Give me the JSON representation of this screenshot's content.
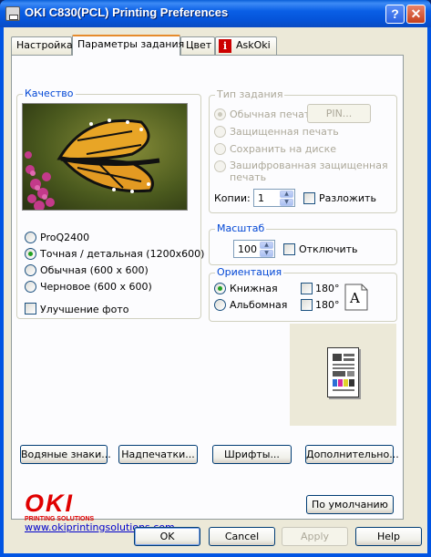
{
  "window": {
    "title": "OKI C830(PCL) Printing Preferences",
    "help_glyph": "?",
    "close_glyph": "✕"
  },
  "tabs": [
    {
      "label": "Настройка"
    },
    {
      "label": "Параметры задания"
    },
    {
      "label": "Цвет"
    },
    {
      "label": "AskOki"
    }
  ],
  "quality": {
    "label": "Качество",
    "options": [
      {
        "label": "ProQ2400",
        "selected": false
      },
      {
        "label": "Точная / детальная (1200x600)",
        "selected": true
      },
      {
        "label": "Обычная (600 x 600)",
        "selected": false
      },
      {
        "label": "Черновое (600 x 600)",
        "selected": false
      }
    ],
    "photo_enhance": {
      "label": "Улучшение фото",
      "checked": false
    }
  },
  "job_type": {
    "label": "Тип задания",
    "options": [
      {
        "label": "Обычная печать",
        "selected": true
      },
      {
        "label": "Защищенная печать",
        "selected": false
      },
      {
        "label": "Сохранить на диске",
        "selected": false
      },
      {
        "label": "Зашифрованная защищенная",
        "selected": false
      }
    ],
    "option4_line2": "печать",
    "pin_button": "PIN...",
    "copies_label": "Копии:",
    "copies_value": "1",
    "collate": {
      "label": "Разложить",
      "checked": false
    }
  },
  "scale": {
    "label": "Масштаб",
    "value": "100",
    "disable": {
      "label": "Отключить",
      "checked": false
    }
  },
  "orientation": {
    "label": "Ориентация",
    "portrait": {
      "label": "Книжная",
      "selected": true
    },
    "landscape": {
      "label": "Альбомная",
      "selected": false
    },
    "rotate_portrait": {
      "label": "180°",
      "checked": false
    },
    "rotate_landscape": {
      "label": "180°",
      "checked": false
    },
    "icon_letter": "A"
  },
  "buttons": {
    "watermarks": "Водяные знаки...",
    "overlays": "Надпечатки...",
    "fonts": "Шрифты...",
    "advanced": "Дополнительно...",
    "defaults": "По умолчанию",
    "ok": "OK",
    "cancel": "Cancel",
    "apply": "Apply",
    "help": "Help"
  },
  "brand": {
    "logo": "OKI",
    "tagline": "PRINTING SOLUTIONS",
    "url": "www.okiprintingsolutions.com",
    "color": "#e00000"
  },
  "askoki_icon_glyph": "i"
}
